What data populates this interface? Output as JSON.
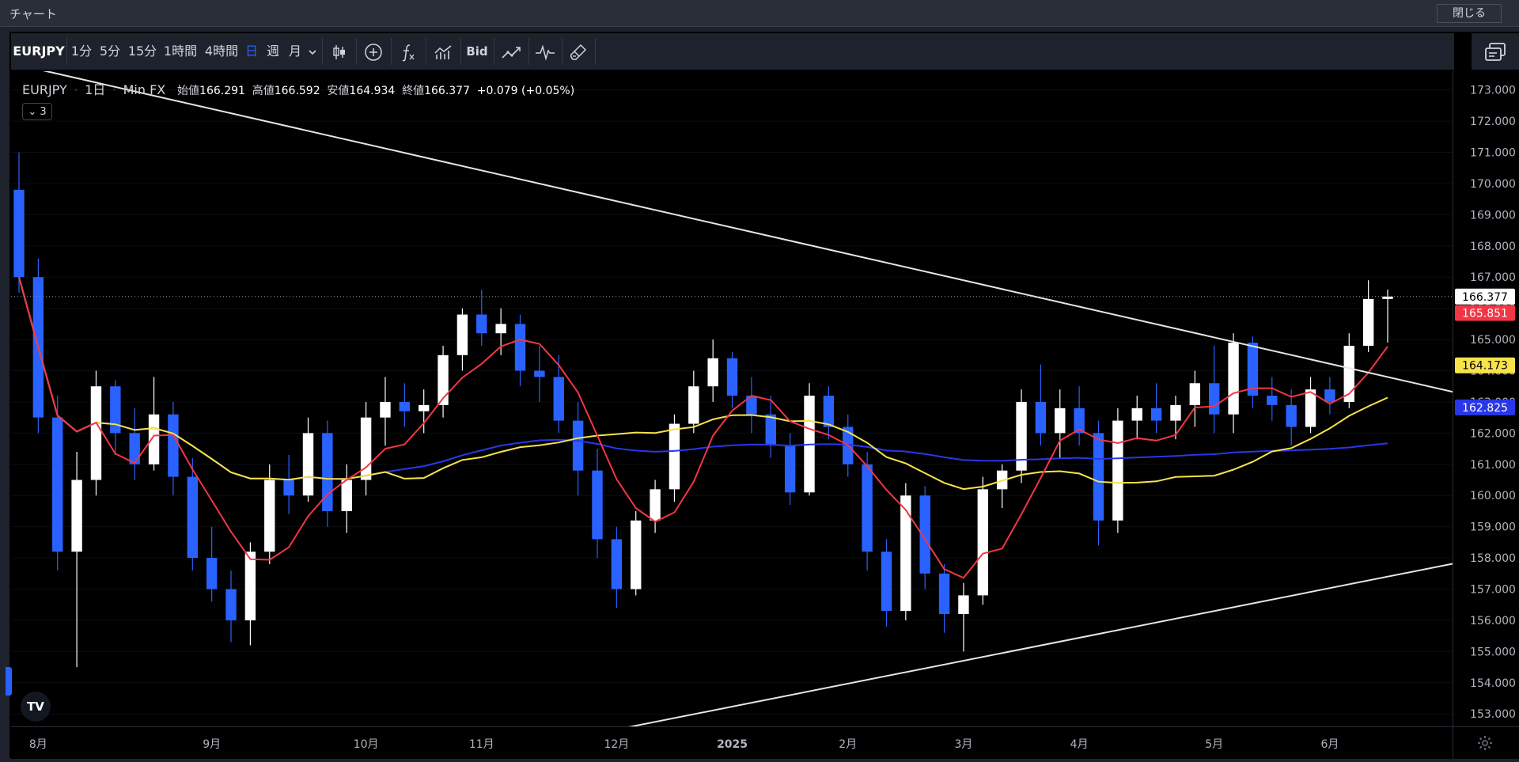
{
  "window": {
    "title": "チャート",
    "close_label": "閉じる"
  },
  "toolbar": {
    "symbol": "EURJPY",
    "intervals": [
      "1分",
      "5分",
      "15分",
      "1時間",
      "4時間",
      "日",
      "週",
      "月"
    ],
    "active_interval": "日",
    "bid_label": "Bid",
    "icons": [
      "chevron-down-icon",
      "candlestick-icon",
      "add-circle-icon",
      "function-icon",
      "bar-chart-icon",
      "line-chart-icon",
      "pulse-icon",
      "brush-icon",
      "layout-icon"
    ]
  },
  "legend": {
    "symbol": "EURJPY",
    "interval": "1日",
    "source": "Min FX",
    "open_label": "始値",
    "open": "166.291",
    "high_label": "高値",
    "high": "166.592",
    "low_label": "安値",
    "low": "164.934",
    "close_label": "終値",
    "close": "166.377",
    "change": "+0.079 (+0.05%)",
    "collapse_count": "3"
  },
  "logo_text": "TV",
  "chart_data": {
    "type": "candlestick",
    "x_labels": [
      "8月",
      "9月",
      "10月",
      "11月",
      "12月",
      "2025",
      "2月",
      "3月",
      "4月",
      "5月",
      "6月"
    ],
    "y_ticks": [
      "173.000",
      "172.000",
      "171.000",
      "170.000",
      "169.000",
      "168.000",
      "167.000",
      "166.000",
      "165.000",
      "164.000",
      "163.000",
      "162.000",
      "161.000",
      "160.000",
      "159.000",
      "158.000",
      "157.000",
      "156.000",
      "155.000",
      "154.000",
      "153.000"
    ],
    "ylim": [
      152.6,
      173.6
    ],
    "price_badges": [
      {
        "label": "166.377",
        "value": 166.377,
        "bg": "#ffffff",
        "fg": "#000000"
      },
      {
        "label": "165.851",
        "value": 165.851,
        "bg": "#f23645",
        "fg": "#ffffff"
      },
      {
        "label": "164.173",
        "value": 164.173,
        "bg": "#f7e34b",
        "fg": "#000000"
      },
      {
        "label": "162.825",
        "value": 162.825,
        "bg": "#2937e8",
        "fg": "#ffffff"
      }
    ],
    "candles": [
      {
        "m": "7月",
        "o": 169.8,
        "h": 171.0,
        "l": 166.5,
        "c": 167.0
      },
      {
        "m": "8月",
        "o": 167.0,
        "h": 167.6,
        "l": 162.0,
        "c": 162.5
      },
      {
        "m": "8月",
        "o": 162.5,
        "h": 163.2,
        "l": 157.6,
        "c": 158.2
      },
      {
        "m": "8月",
        "o": 158.2,
        "h": 161.4,
        "l": 154.5,
        "c": 160.5
      },
      {
        "m": "8月",
        "o": 160.5,
        "h": 164.0,
        "l": 160.0,
        "c": 163.5
      },
      {
        "m": "8月",
        "o": 163.5,
        "h": 163.7,
        "l": 161.3,
        "c": 162.0
      },
      {
        "m": "8月",
        "o": 162.0,
        "h": 162.8,
        "l": 160.5,
        "c": 161.0
      },
      {
        "m": "8月",
        "o": 161.0,
        "h": 163.8,
        "l": 160.8,
        "c": 162.6
      },
      {
        "m": "8月",
        "o": 162.6,
        "h": 163.0,
        "l": 160.0,
        "c": 160.6
      },
      {
        "m": "8月",
        "o": 160.6,
        "h": 161.2,
        "l": 157.6,
        "c": 158.0
      },
      {
        "m": "9月",
        "o": 158.0,
        "h": 159.0,
        "l": 156.6,
        "c": 157.0
      },
      {
        "m": "9月",
        "o": 157.0,
        "h": 157.6,
        "l": 155.3,
        "c": 156.0
      },
      {
        "m": "9月",
        "o": 156.0,
        "h": 158.5,
        "l": 155.2,
        "c": 158.2
      },
      {
        "m": "9月",
        "o": 158.2,
        "h": 161.0,
        "l": 157.8,
        "c": 160.5
      },
      {
        "m": "9月",
        "o": 160.5,
        "h": 161.3,
        "l": 159.4,
        "c": 160.0
      },
      {
        "m": "9月",
        "o": 160.0,
        "h": 162.5,
        "l": 159.8,
        "c": 162.0
      },
      {
        "m": "9月",
        "o": 162.0,
        "h": 162.4,
        "l": 159.0,
        "c": 159.5
      },
      {
        "m": "9月",
        "o": 159.5,
        "h": 161.0,
        "l": 158.8,
        "c": 160.5
      },
      {
        "m": "10月",
        "o": 160.5,
        "h": 163.0,
        "l": 160.0,
        "c": 162.5
      },
      {
        "m": "10月",
        "o": 162.5,
        "h": 163.8,
        "l": 161.6,
        "c": 163.0
      },
      {
        "m": "10月",
        "o": 163.0,
        "h": 163.6,
        "l": 162.2,
        "c": 162.7
      },
      {
        "m": "10月",
        "o": 162.7,
        "h": 163.4,
        "l": 162.0,
        "c": 162.9
      },
      {
        "m": "10月",
        "o": 162.9,
        "h": 164.8,
        "l": 162.5,
        "c": 164.5
      },
      {
        "m": "10月",
        "o": 164.5,
        "h": 166.0,
        "l": 164.0,
        "c": 165.8
      },
      {
        "m": "11月",
        "o": 165.8,
        "h": 166.6,
        "l": 164.8,
        "c": 165.2
      },
      {
        "m": "11月",
        "o": 165.2,
        "h": 166.0,
        "l": 164.5,
        "c": 165.5
      },
      {
        "m": "11月",
        "o": 165.5,
        "h": 165.8,
        "l": 163.5,
        "c": 164.0
      },
      {
        "m": "11月",
        "o": 164.0,
        "h": 164.8,
        "l": 163.0,
        "c": 163.8
      },
      {
        "m": "11月",
        "o": 163.8,
        "h": 164.5,
        "l": 162.0,
        "c": 162.4
      },
      {
        "m": "11月",
        "o": 162.4,
        "h": 163.0,
        "l": 160.0,
        "c": 160.8
      },
      {
        "m": "11月",
        "o": 160.8,
        "h": 161.5,
        "l": 158.0,
        "c": 158.6
      },
      {
        "m": "12月",
        "o": 158.6,
        "h": 159.0,
        "l": 156.4,
        "c": 157.0
      },
      {
        "m": "12月",
        "o": 157.0,
        "h": 159.5,
        "l": 156.8,
        "c": 159.2
      },
      {
        "m": "12月",
        "o": 159.2,
        "h": 160.5,
        "l": 158.8,
        "c": 160.2
      },
      {
        "m": "12月",
        "o": 160.2,
        "h": 162.6,
        "l": 159.8,
        "c": 162.3
      },
      {
        "m": "12月",
        "o": 162.3,
        "h": 164.0,
        "l": 162.0,
        "c": 163.5
      },
      {
        "m": "12月",
        "o": 163.5,
        "h": 165.0,
        "l": 163.0,
        "c": 164.4
      },
      {
        "m": "2025",
        "o": 164.4,
        "h": 164.6,
        "l": 162.8,
        "c": 163.2
      },
      {
        "m": "2025",
        "o": 163.2,
        "h": 163.8,
        "l": 162.0,
        "c": 162.6
      },
      {
        "m": "2025",
        "o": 162.6,
        "h": 163.2,
        "l": 161.2,
        "c": 161.6
      },
      {
        "m": "2025",
        "o": 161.6,
        "h": 162.0,
        "l": 159.7,
        "c": 160.1
      },
      {
        "m": "2025",
        "o": 160.1,
        "h": 163.6,
        "l": 160.0,
        "c": 163.2
      },
      {
        "m": "2025",
        "o": 163.2,
        "h": 163.5,
        "l": 161.8,
        "c": 162.2
      },
      {
        "m": "2月",
        "o": 162.2,
        "h": 162.6,
        "l": 160.6,
        "c": 161.0
      },
      {
        "m": "2月",
        "o": 161.0,
        "h": 161.4,
        "l": 157.6,
        "c": 158.2
      },
      {
        "m": "2月",
        "o": 158.2,
        "h": 158.6,
        "l": 155.8,
        "c": 156.3
      },
      {
        "m": "2月",
        "o": 156.3,
        "h": 160.4,
        "l": 156.0,
        "c": 160.0
      },
      {
        "m": "2月",
        "o": 160.0,
        "h": 160.3,
        "l": 157.0,
        "c": 157.5
      },
      {
        "m": "2月",
        "o": 157.5,
        "h": 157.8,
        "l": 155.6,
        "c": 156.2
      },
      {
        "m": "3月",
        "o": 156.2,
        "h": 157.2,
        "l": 155.0,
        "c": 156.8
      },
      {
        "m": "3月",
        "o": 156.8,
        "h": 160.6,
        "l": 156.5,
        "c": 160.2
      },
      {
        "m": "3月",
        "o": 160.2,
        "h": 161.0,
        "l": 159.6,
        "c": 160.8
      },
      {
        "m": "3月",
        "o": 160.8,
        "h": 163.4,
        "l": 160.4,
        "c": 163.0
      },
      {
        "m": "3月",
        "o": 163.0,
        "h": 164.2,
        "l": 161.6,
        "c": 162.0
      },
      {
        "m": "3月",
        "o": 162.0,
        "h": 163.4,
        "l": 161.2,
        "c": 162.8
      },
      {
        "m": "4月",
        "o": 162.8,
        "h": 163.5,
        "l": 161.6,
        "c": 162.0
      },
      {
        "m": "4月",
        "o": 162.0,
        "h": 162.4,
        "l": 158.4,
        "c": 159.2
      },
      {
        "m": "4月",
        "o": 159.2,
        "h": 162.8,
        "l": 158.8,
        "c": 162.4
      },
      {
        "m": "4月",
        "o": 162.4,
        "h": 163.2,
        "l": 161.8,
        "c": 162.8
      },
      {
        "m": "4月",
        "o": 162.8,
        "h": 163.6,
        "l": 162.0,
        "c": 162.4
      },
      {
        "m": "4月",
        "o": 162.4,
        "h": 163.2,
        "l": 161.8,
        "c": 162.9
      },
      {
        "m": "4月",
        "o": 162.9,
        "h": 164.0,
        "l": 162.2,
        "c": 163.6
      },
      {
        "m": "5月",
        "o": 163.6,
        "h": 164.8,
        "l": 162.0,
        "c": 162.6
      },
      {
        "m": "5月",
        "o": 162.6,
        "h": 165.2,
        "l": 162.0,
        "c": 164.9
      },
      {
        "m": "5月",
        "o": 164.9,
        "h": 165.1,
        "l": 162.8,
        "c": 163.2
      },
      {
        "m": "5月",
        "o": 163.2,
        "h": 163.8,
        "l": 162.4,
        "c": 162.9
      },
      {
        "m": "5月",
        "o": 162.9,
        "h": 163.4,
        "l": 161.6,
        "c": 162.2
      },
      {
        "m": "5月",
        "o": 162.2,
        "h": 163.8,
        "l": 162.0,
        "c": 163.4
      },
      {
        "m": "6月",
        "o": 163.4,
        "h": 163.8,
        "l": 162.6,
        "c": 163.0
      },
      {
        "m": "6月",
        "o": 163.0,
        "h": 165.2,
        "l": 162.8,
        "c": 164.8
      },
      {
        "m": "6月",
        "o": 164.8,
        "h": 166.9,
        "l": 164.6,
        "c": 166.3
      },
      {
        "m": "6月",
        "o": 166.3,
        "h": 166.6,
        "l": 164.9,
        "c": 166.377
      }
    ],
    "trendlines": [
      {
        "name": "upper",
        "points": [
          [
            "7月",
            173.8
          ],
          [
            "6月",
            163.8
          ]
        ]
      },
      {
        "name": "lower",
        "points": [
          [
            "12月",
            152.5
          ],
          [
            "6月",
            157.4
          ]
        ]
      }
    ],
    "ma_colors": {
      "fast": "#f23645",
      "mid": "#f7e34b",
      "slow": "#2937e8"
    },
    "ma_periods": {
      "fast": 5,
      "mid": 20,
      "slow": 75
    },
    "last_price": 166.377
  }
}
